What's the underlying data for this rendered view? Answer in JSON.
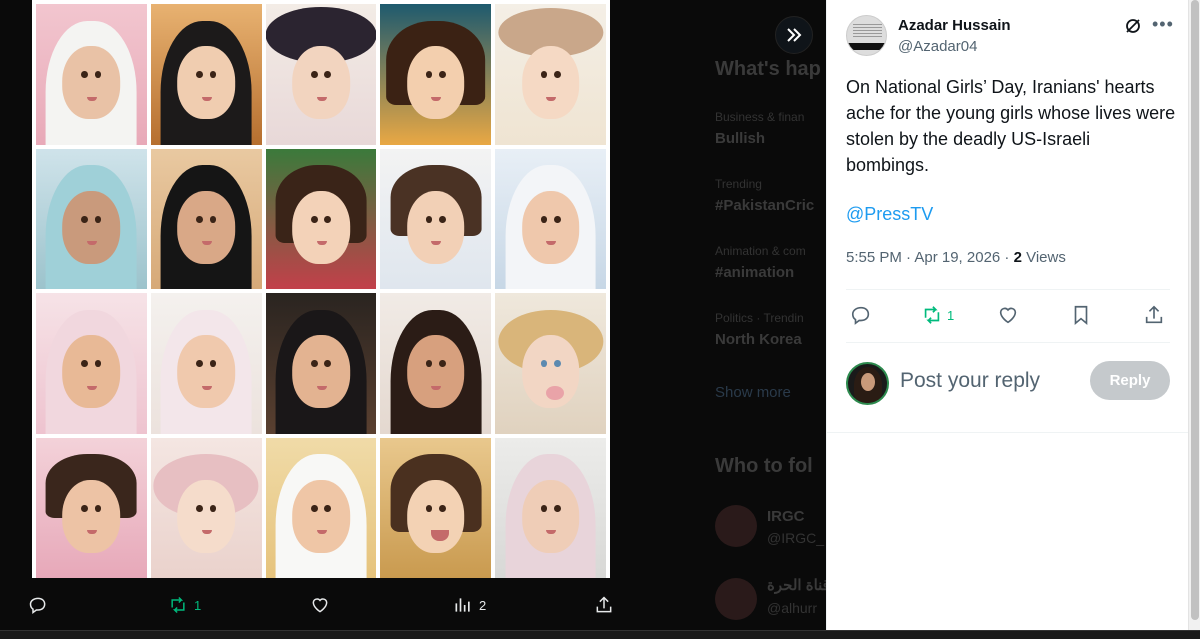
{
  "tweet": {
    "author_name": "Azadar Hussain",
    "author_handle": "@Azadar04",
    "text": "On National Girls’ Day, Iranians' hearts ache for the young girls whose lives were stolen by the deadly US-Israeli bombings.",
    "mention": "@PressTV",
    "time": "5:55 PM · Apr 19, 2026 · ",
    "views_count": "2",
    "views_label": " Views",
    "retweet_count": "1"
  },
  "viewer_actions": {
    "retweet_count": "1",
    "views_count": "2"
  },
  "reply": {
    "placeholder": "Post your reply",
    "button_label": "Reply"
  },
  "background_sidebar": {
    "heading": "What's hap",
    "trends": [
      {
        "meta": "Business & finan",
        "title": "Bullish"
      },
      {
        "meta": "Trending",
        "title": "#PakistanCric"
      },
      {
        "meta": "Animation & com",
        "title": "#animation"
      },
      {
        "meta": "Politics · Trendin",
        "title": "North Korea"
      }
    ],
    "show_more": "Show more",
    "who_to_follow": "Who to fol",
    "accounts": [
      {
        "name": "IRGC",
        "handle": "@IRGC_"
      },
      {
        "name": "قناة الحرة",
        "handle": "@alhurr"
      }
    ]
  },
  "colors": {
    "accent": "#1d9bf0",
    "retweet_green": "#00ba7c"
  },
  "icons": [
    "expand-icon",
    "reply-icon",
    "retweet-icon",
    "like-icon",
    "views-icon",
    "share-icon",
    "bookmark-icon",
    "grok-icon",
    "more-icon"
  ]
}
